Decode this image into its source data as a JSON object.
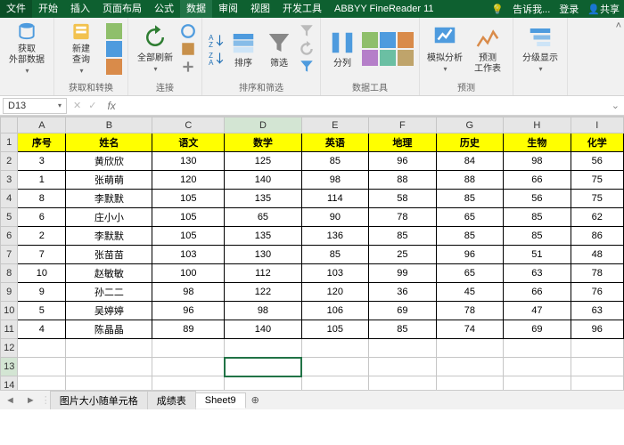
{
  "tabs": {
    "file": "文件",
    "items": [
      "开始",
      "插入",
      "页面布局",
      "公式",
      "数据",
      "审阅",
      "视图",
      "开发工具",
      "ABBYY FineReader 11"
    ],
    "active": "数据",
    "tell": "告诉我...",
    "login": "登录",
    "share": "共享"
  },
  "ribbon": {
    "g1": {
      "b1": "获取\n外部数据"
    },
    "g2": {
      "b1": "新建\n查询",
      "label": "获取和转换"
    },
    "g3": {
      "b1": "全部刷新",
      "label": "连接"
    },
    "g4": {
      "b1": "排序",
      "b2": "筛选",
      "label": "排序和筛选"
    },
    "g5": {
      "b1": "分列",
      "label": "数据工具"
    },
    "g6": {
      "b1": "模拟分析",
      "b2": "预测\n工作表",
      "label": "预测"
    },
    "g7": {
      "b1": "分级显示"
    }
  },
  "fx": {
    "name": "D13",
    "formula": ""
  },
  "headers": [
    "",
    "A",
    "B",
    "C",
    "D",
    "E",
    "F",
    "G",
    "H",
    "I"
  ],
  "hrow": [
    "序号",
    "姓名",
    "语文",
    "数学",
    "英语",
    "地理",
    "历史",
    "生物",
    "化学"
  ],
  "rows": [
    [
      "3",
      "黄欣欣",
      "130",
      "125",
      "85",
      "96",
      "84",
      "98",
      "56"
    ],
    [
      "1",
      "张萌萌",
      "120",
      "140",
      "98",
      "88",
      "88",
      "66",
      "75"
    ],
    [
      "8",
      "李默默",
      "105",
      "135",
      "114",
      "58",
      "85",
      "56",
      "75"
    ],
    [
      "6",
      "庄小小",
      "105",
      "65",
      "90",
      "78",
      "65",
      "85",
      "62"
    ],
    [
      "2",
      "李默默",
      "105",
      "135",
      "136",
      "85",
      "85",
      "85",
      "86"
    ],
    [
      "7",
      "张苗苗",
      "103",
      "130",
      "85",
      "25",
      "96",
      "51",
      "48"
    ],
    [
      "10",
      "赵敏敏",
      "100",
      "112",
      "103",
      "99",
      "65",
      "63",
      "78"
    ],
    [
      "9",
      "孙二二",
      "98",
      "122",
      "120",
      "36",
      "45",
      "66",
      "76"
    ],
    [
      "5",
      "吴婷婷",
      "96",
      "98",
      "106",
      "69",
      "78",
      "47",
      "63"
    ],
    [
      "4",
      "陈晶晶",
      "89",
      "140",
      "105",
      "85",
      "74",
      "69",
      "96"
    ]
  ],
  "sheetnav": {
    "tabs": [
      "图片大小随单元格",
      "成绩表",
      "Sheet9"
    ],
    "active": "Sheet9"
  },
  "cursor": {
    "row": 13,
    "col": "D"
  }
}
